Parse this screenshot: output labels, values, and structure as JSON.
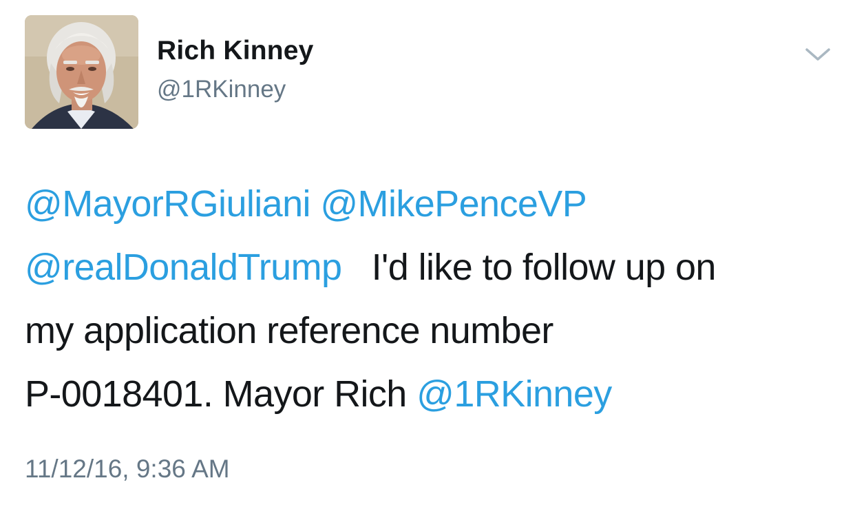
{
  "author": {
    "name": "Rich Kinney",
    "handle": "@1RKinney",
    "avatar_icon": "profile-photo"
  },
  "menu": {
    "icon": "chevron-down-icon"
  },
  "tweet": {
    "mentions": [
      "@MayorRGiuliani",
      "@MikePenceVP",
      "@realDonaldTrump"
    ],
    "text_line2": "I'd like to follow up on",
    "text_line3": "my application reference number",
    "text_line4": "P-0018401. Mayor Rich",
    "signature_mention": "@1RKinney",
    "timestamp": "11/12/16, 9:36 AM"
  },
  "colors": {
    "mention": "#2b9fe0",
    "text": "#14171a",
    "secondary": "#657786"
  }
}
